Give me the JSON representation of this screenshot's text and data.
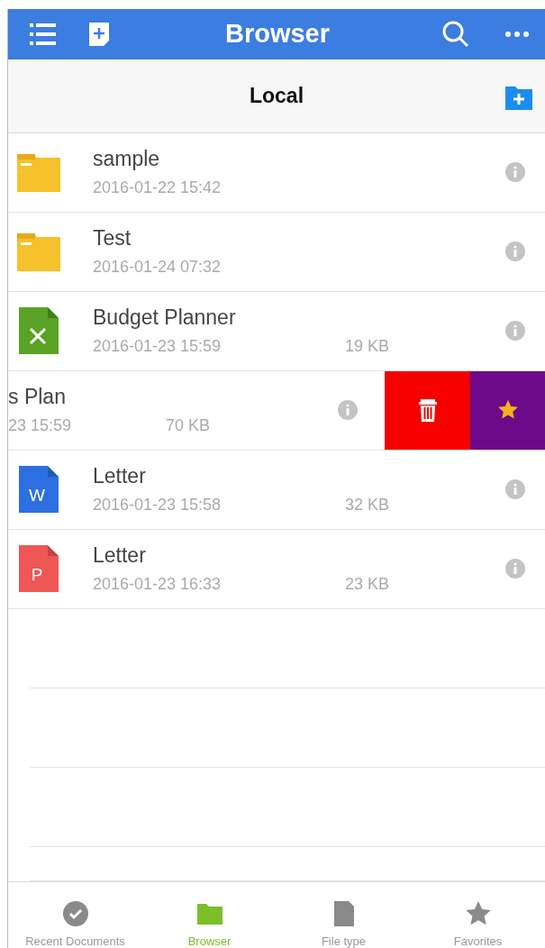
{
  "header": {
    "title": "Browser"
  },
  "location_bar": {
    "title": "Local"
  },
  "files": [
    {
      "kind": "folder",
      "name": "sample",
      "date": "2016-01-22 15:42",
      "swiped": false
    },
    {
      "kind": "folder",
      "name": "Test",
      "date": "2016-01-24 07:32",
      "swiped": false
    },
    {
      "kind": "excel",
      "name": "Budget Planner",
      "date": "2016-01-23 15:59",
      "size": "19 KB",
      "swiped": false
    },
    {
      "name": "s Plan",
      "date": "23 15:59",
      "size": "70 KB",
      "swiped": true
    },
    {
      "kind": "word",
      "letter": "W",
      "name": "Letter",
      "date": "2016-01-23 15:58",
      "size": "32 KB",
      "swiped": false
    },
    {
      "kind": "powerpoint",
      "letter": "P",
      "name": "Letter",
      "date": "2016-01-23 16:33",
      "size": "23 KB",
      "swiped": false
    }
  ],
  "tabs": [
    {
      "kind": "recent",
      "label": "Recent Documents",
      "selected": false
    },
    {
      "kind": "browser",
      "label": "Browser",
      "selected": true
    },
    {
      "kind": "filetype",
      "label": "File type",
      "selected": false
    },
    {
      "kind": "favorites",
      "label": "Favorites",
      "selected": false
    }
  ]
}
